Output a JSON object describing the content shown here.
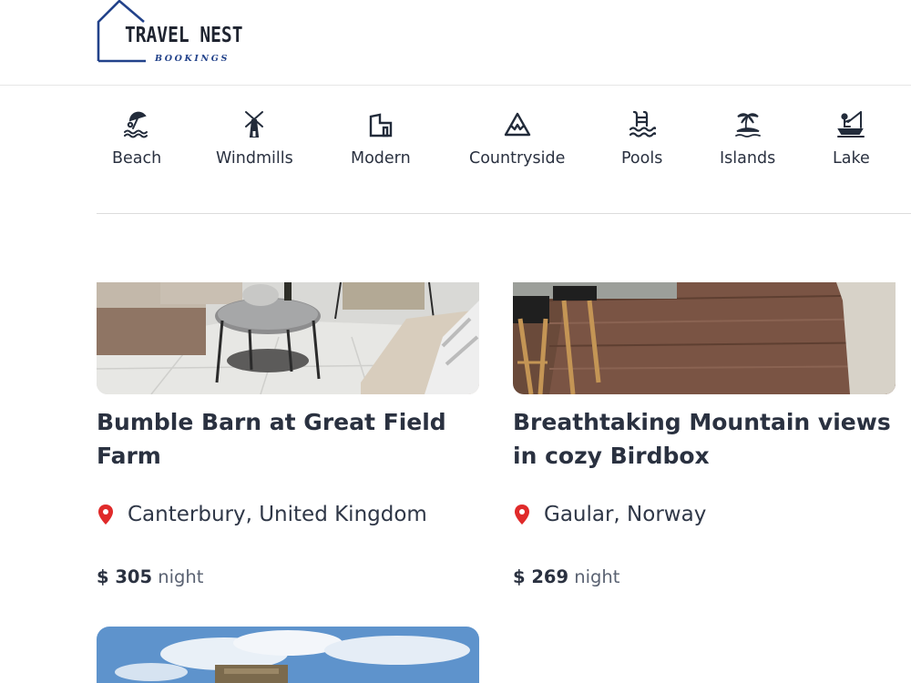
{
  "brand": {
    "title": "TRAVEL NEST",
    "subtitle": "BOOKINGS",
    "accent_color": "#22428a"
  },
  "categories": [
    {
      "label": "Beach",
      "icon": "beach-umbrella-icon"
    },
    {
      "label": "Windmills",
      "icon": "windmill-icon"
    },
    {
      "label": "Modern",
      "icon": "modern-house-icon"
    },
    {
      "label": "Countryside",
      "icon": "mountain-icon"
    },
    {
      "label": "Pools",
      "icon": "pool-ladder-icon"
    },
    {
      "label": "Islands",
      "icon": "island-palm-icon"
    },
    {
      "label": "Lake",
      "icon": "fishing-icon"
    }
  ],
  "listings": [
    {
      "title": "Bumble Barn at Great Field Farm",
      "location": "Canterbury, United Kingdom",
      "price": "$ 305",
      "price_unit": "night",
      "location_icon": "map-pin-icon",
      "pin_color": "#e02a2a"
    },
    {
      "title": "Breathtaking Mountain views in cozy Birdbox",
      "location": "Gaular, Norway",
      "price": "$ 269",
      "price_unit": "night",
      "location_icon": "map-pin-icon",
      "pin_color": "#e02a2a"
    }
  ]
}
